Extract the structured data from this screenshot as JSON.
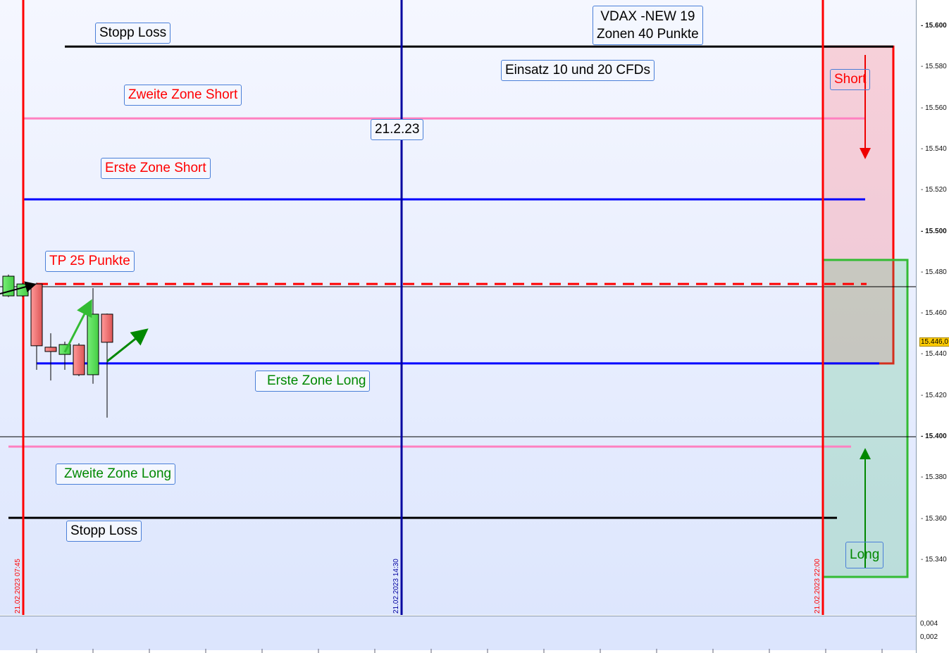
{
  "chart_data": {
    "type": "candlestick",
    "title": "VDAX -NEW 19 Zonen 40 Punkte",
    "ylim": [
      15310,
      15610
    ],
    "y_ticks": [
      "15.600",
      "15.580",
      "15.560",
      "15.540",
      "15.520",
      "15.500",
      "15.480",
      "15.460",
      "15.440",
      "15.420",
      "15.400",
      "15.380",
      "15.360",
      "15.340"
    ],
    "y_tick_values": [
      15600,
      15580,
      15560,
      15540,
      15520,
      15500,
      15480,
      15460,
      15440,
      15420,
      15400,
      15380,
      15360,
      15340
    ],
    "current_price_label": "15.446,0",
    "current_price": 15446,
    "sub_ticks": [
      "0,004",
      "0,002"
    ],
    "candles": [
      {
        "o": 15468.6,
        "h": 15479,
        "l": 15468,
        "c": 15478.2
      },
      {
        "o": 15468.6,
        "h": 15475,
        "l": 15468,
        "c": 15474.4
      },
      {
        "o": 15474.4,
        "h": 15475,
        "l": 15432.6,
        "c": 15444.3
      },
      {
        "o": 15443.6,
        "h": 15450.4,
        "l": 15427.4,
        "c": 15441.5
      },
      {
        "o": 15440.1,
        "h": 15446.3,
        "l": 15432.6,
        "c": 15444.9
      },
      {
        "o": 15444.6,
        "h": 15445.6,
        "l": 15429.5,
        "c": 15430.2
      },
      {
        "o": 15430.2,
        "h": 15472.4,
        "l": 15425.8,
        "c": 15459.7
      },
      {
        "o": 15459.7,
        "h": 15460,
        "l": 15409.3,
        "c": 15446.0
      }
    ],
    "levels": [
      {
        "name": "Stopp Loss",
        "price": 15590,
        "color": "#000000"
      },
      {
        "name": "Zweite Zone Short",
        "price": 15555,
        "color": "#ff80c0"
      },
      {
        "name": "Erste Zone Short",
        "price": 15515.6,
        "color": "#0000ff"
      },
      {
        "name": "TP 25 Punkte",
        "price": 15474.4,
        "color": "#ff0000",
        "dashed": true
      },
      {
        "name": "Erste Zone Long",
        "price": 15435.7,
        "color": "#0000ff"
      },
      {
        "name": "Zweite Zone Long",
        "price": 15395.2,
        "color": "#ff80c0"
      },
      {
        "name": "Stopp Loss",
        "price": 15360.5,
        "color": "#000000"
      }
    ],
    "vlines": [
      {
        "label": "21.02.2023 07:45",
        "color": "#ff0000"
      },
      {
        "label": "21.02.2023 14:30",
        "color": "#0000a0"
      },
      {
        "label": "21.02.2023 22:00",
        "color": "#ff0000"
      }
    ],
    "annotations": {
      "stopp_top": "Stopp Loss",
      "vdax_line1": "VDAX -NEW 19",
      "vdax_line2": "Zonen 40 Punkte",
      "einsatz": "Einsatz 10 und 20 CFDs",
      "short": "Short",
      "zweite_short": "Zweite  Zone Short",
      "date": "21.2.23",
      "erste_short": "Erste  Zone Short",
      "tp": "TP 25 Punkte",
      "erste_long": "Erste Zone Long",
      "zweite_long": "Zweite Zone Long",
      "stopp_bottom": "Stopp Loss",
      "long": "Long"
    }
  }
}
